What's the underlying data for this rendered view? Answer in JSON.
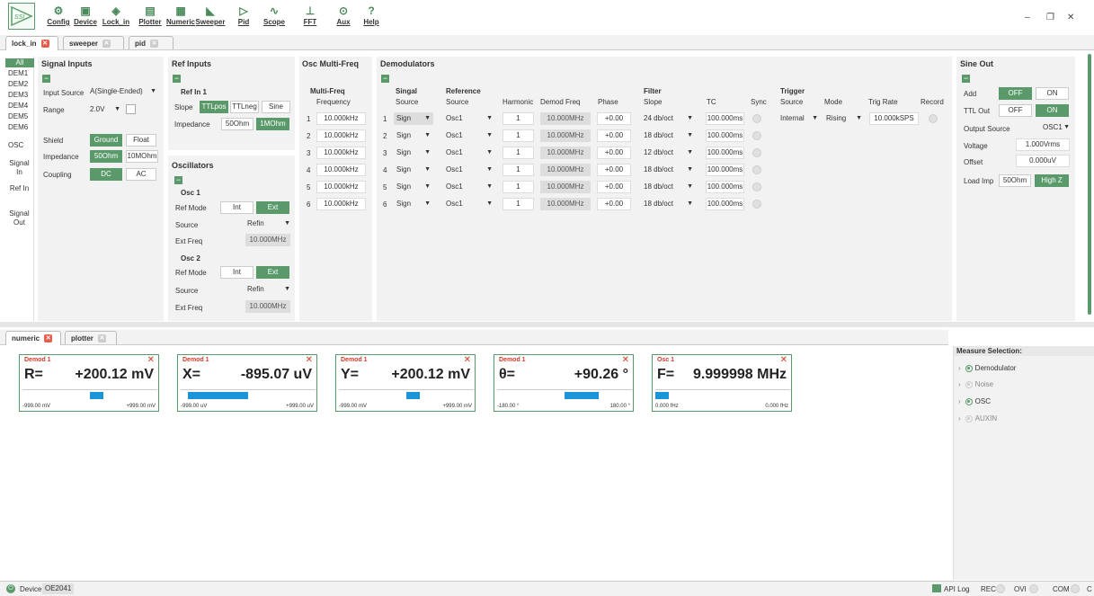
{
  "toolbar": {
    "items": [
      "Config",
      "Device",
      "Lock_in",
      "Plotter",
      "Numeric",
      "Sweeper",
      "Pid",
      "Scope",
      "FFT",
      "Aux",
      "Help"
    ]
  },
  "tabs_top": [
    "lock_in",
    "sweeper",
    "pid"
  ],
  "nav": [
    "All",
    "DEM1",
    "DEM2",
    "DEM3",
    "DEM4",
    "DEM5",
    "DEM6",
    "OSC",
    "Signal In",
    "Ref In",
    "Signal Out"
  ],
  "signal_inputs": {
    "title": "Signal Inputs",
    "input_source_label": "Input Source",
    "input_source": "A(Single-Ended)",
    "range_label": "Range",
    "range": "2.0V",
    "shield_label": "Shield",
    "shield_opts": [
      "Ground",
      "Float"
    ],
    "impedance_label": "Impedance",
    "impedance_opts": [
      "50Ohm",
      "10MOhm"
    ],
    "coupling_label": "Coupling",
    "coupling_opts": [
      "DC",
      "AC"
    ]
  },
  "ref_inputs": {
    "title": "Ref Inputs",
    "sub": "Ref In 1",
    "slope_label": "Slope",
    "slope_opts": [
      "TTLpos",
      "TTLneg",
      "Sine"
    ],
    "imp_label": "Impedance",
    "imp_opts": [
      "50Ohm",
      "1MOhm"
    ]
  },
  "oscillators": {
    "title": "Oscillators",
    "osc1": "Osc 1",
    "osc2": "Osc 2",
    "refmode_label": "Ref Mode",
    "refmode_opts": [
      "Int",
      "Ext"
    ],
    "source_label": "Source",
    "source": "Refin",
    "extfreq_label": "Ext Freq",
    "extfreq": "10.000MHz"
  },
  "osc_multi": {
    "title": "Osc Multi-Freq",
    "sub": "Multi-Freq",
    "col": "Frequency",
    "rows": [
      "10.000kHz",
      "10.000kHz",
      "10.000kHz",
      "10.000kHz",
      "10.000kHz",
      "10.000kHz"
    ],
    "idx": [
      "1",
      "2",
      "3",
      "4",
      "5",
      "6"
    ]
  },
  "demod": {
    "title": "Demodulators",
    "h_signal": "Singal",
    "h_source": "Source",
    "h_ref": "Reference",
    "h_refsrc": "Source",
    "h_harm": "Harmonic",
    "h_dfreq": "Demod Freq",
    "h_phase": "Phase",
    "h_filter": "Filter",
    "h_slope": "Slope",
    "h_tc": "TC",
    "h_sync": "Sync",
    "h_trig": "Trigger",
    "h_tsrc": "Source",
    "h_mode": "Mode",
    "h_rate": "Trig Rate",
    "h_rec": "Record",
    "rows": [
      {
        "i": "1",
        "sig": "Sign",
        "ref": "Osc1",
        "harm": "1",
        "freq": "10.000MHz",
        "phase": "+0.00",
        "slope": "24 db/oct",
        "tc": "100.000ms",
        "tsrc": "Internal",
        "mode": "Rising",
        "rate": "10.000kSPS"
      },
      {
        "i": "2",
        "sig": "Sign",
        "ref": "Osc1",
        "harm": "1",
        "freq": "10.000MHz",
        "phase": "+0.00",
        "slope": "18 db/oct",
        "tc": "100.000ms"
      },
      {
        "i": "3",
        "sig": "Sign",
        "ref": "Osc1",
        "harm": "1",
        "freq": "10.000MHz",
        "phase": "+0.00",
        "slope": "12 db/oct",
        "tc": "100.000ms"
      },
      {
        "i": "4",
        "sig": "Sign",
        "ref": "Osc1",
        "harm": "1",
        "freq": "10.000MHz",
        "phase": "+0.00",
        "slope": "18 db/oct",
        "tc": "100.000ms"
      },
      {
        "i": "5",
        "sig": "Sign",
        "ref": "Osc1",
        "harm": "1",
        "freq": "10.000MHz",
        "phase": "+0.00",
        "slope": "18 db/oct",
        "tc": "100.000ms"
      },
      {
        "i": "6",
        "sig": "Sign",
        "ref": "Osc1",
        "harm": "1",
        "freq": "10.000MHz",
        "phase": "+0.00",
        "slope": "18 db/oct",
        "tc": "100.000ms"
      }
    ]
  },
  "sine_out": {
    "title": "Sine Out",
    "add_label": "Add",
    "add_opts": [
      "OFF",
      "ON"
    ],
    "ttl_label": "TTL Out",
    "ttl_opts": [
      "OFF",
      "ON"
    ],
    "outsrc_label": "Output Source",
    "outsrc": "OSC1",
    "voltage_label": "Voltage",
    "voltage": "1.000Vrms",
    "offset_label": "Offset",
    "offset": "0.000uV",
    "loadimp_label": "Load Imp",
    "loadimp_opts": [
      "50Ohm",
      "High Z"
    ]
  },
  "tabs_bottom": [
    "numeric",
    "plotter"
  ],
  "meters": [
    {
      "title": "Demod 1",
      "sym": "R=",
      "val": "+200.12 mV",
      "min": "-999.00 mV",
      "max": "+999.00 mV",
      "fill_from": 0.5,
      "fill_to": 0.6
    },
    {
      "title": "Demod 1",
      "sym": "X=",
      "val": "-895.07 uV",
      "min": "-999.00 uV",
      "max": "+999.00 uV",
      "fill_from": 0.05,
      "fill_to": 0.5
    },
    {
      "title": "Demod 1",
      "sym": "Y=",
      "val": "+200.12 mV",
      "min": "-999.00 mV",
      "max": "+999.00 mV",
      "fill_from": 0.5,
      "fill_to": 0.6
    },
    {
      "title": "Demod 1",
      "sym": "θ=",
      "val": "+90.26 °",
      "min": "-180.00 °",
      "max": "180.00 °",
      "fill_from": 0.5,
      "fill_to": 0.75
    },
    {
      "title": "Osc 1",
      "sym": "F=",
      "val": "9.999998 MHz",
      "min": "0.000 fHz",
      "max": "0.000 fHz",
      "fill_from": 0.0,
      "fill_to": 0.1
    }
  ],
  "measure": {
    "title": "Measure Selection:",
    "items": [
      "Demodulator",
      "Noise",
      "OSC",
      "AUXIN"
    ]
  },
  "status": {
    "device_label": "Device",
    "device": "OE2041",
    "apilog": "API Log",
    "rec": "REC",
    "ovi": "OVI",
    "com": "COM",
    "c": "C"
  }
}
